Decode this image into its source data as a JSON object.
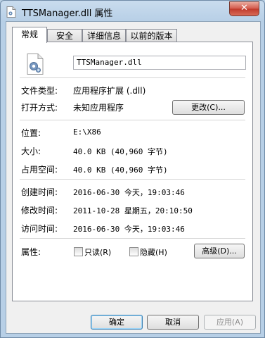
{
  "window": {
    "title": "TTSManager.dll 属性",
    "close_label": "✕"
  },
  "tabs": [
    {
      "label": "常规"
    },
    {
      "label": "安全"
    },
    {
      "label": "详细信息"
    },
    {
      "label": "以前的版本"
    }
  ],
  "general": {
    "file_name": "TTSManager.dll",
    "file_type": {
      "label": "文件类型:",
      "value": "应用程序扩展 (.dll)"
    },
    "opens_with": {
      "label": "打开方式:",
      "value": "未知应用程序",
      "change_button": "更改(C)..."
    },
    "location": {
      "label": "位置:",
      "value": "E:\\X86"
    },
    "size": {
      "label": "大小:",
      "value": "40.0 KB (40,960 字节)"
    },
    "size_on_disk": {
      "label": "占用空间:",
      "value": "40.0 KB (40,960 字节)"
    },
    "created": {
      "label": "创建时间:",
      "value": "2016-06-30 今天，19:03:46"
    },
    "modified": {
      "label": "修改时间:",
      "value": "2011-10-28 星期五，20:10:50"
    },
    "accessed": {
      "label": "访问时间:",
      "value": "2016-06-30 今天，19:03:46"
    },
    "attributes": {
      "label": "属性:",
      "readonly_label": "只读(R)",
      "readonly_checked": false,
      "hidden_label": "隐藏(H)",
      "hidden_checked": false,
      "advanced_button": "高级(D)..."
    }
  },
  "footer": {
    "ok": "确定",
    "cancel": "取消",
    "apply": "应用(A)"
  }
}
